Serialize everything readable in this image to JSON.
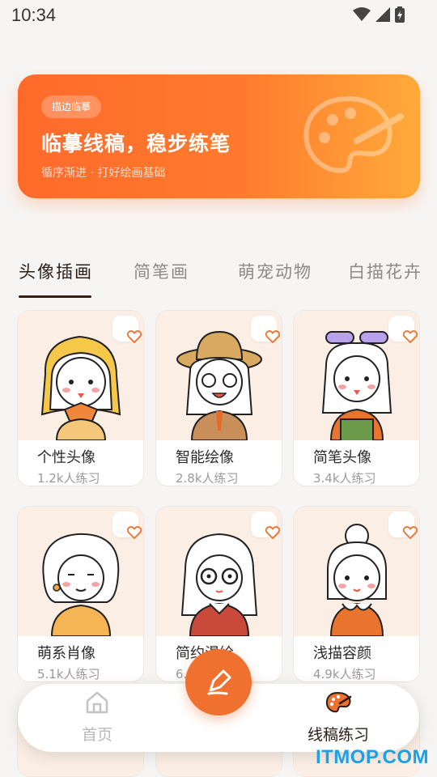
{
  "status_bar": {
    "time": "10:34"
  },
  "banner": {
    "tag": "描边临摹",
    "title": "临摹线稿，稳步练笔",
    "subtitle": "循序渐进 · 打好绘画基础",
    "art_icon": "palette-icon"
  },
  "tabs": [
    {
      "label": "头像插画",
      "active": true
    },
    {
      "label": "简笔画",
      "active": false
    },
    {
      "label": "萌宠动物",
      "active": false
    },
    {
      "label": "白描花卉",
      "active": false
    }
  ],
  "cards": [
    {
      "title": "个性头像",
      "count": "1.2k人练习"
    },
    {
      "title": "智能绘像",
      "count": "2.8k人练习"
    },
    {
      "title": "简笔头像",
      "count": "3.4k人练习"
    },
    {
      "title": "萌系肖像",
      "count": "5.1k人练习"
    },
    {
      "title": "简约漫绘",
      "count": "6.3k人练习"
    },
    {
      "title": "浅描容颜",
      "count": "4.9k人练习"
    }
  ],
  "bottom_nav": {
    "home_label": "首页",
    "practice_label": "线稿练习"
  },
  "watermark": "ITMOP.COM",
  "colors": {
    "accent": "#f07030",
    "banner_start": "#ff6a2b",
    "banner_end": "#ffaa3a"
  }
}
